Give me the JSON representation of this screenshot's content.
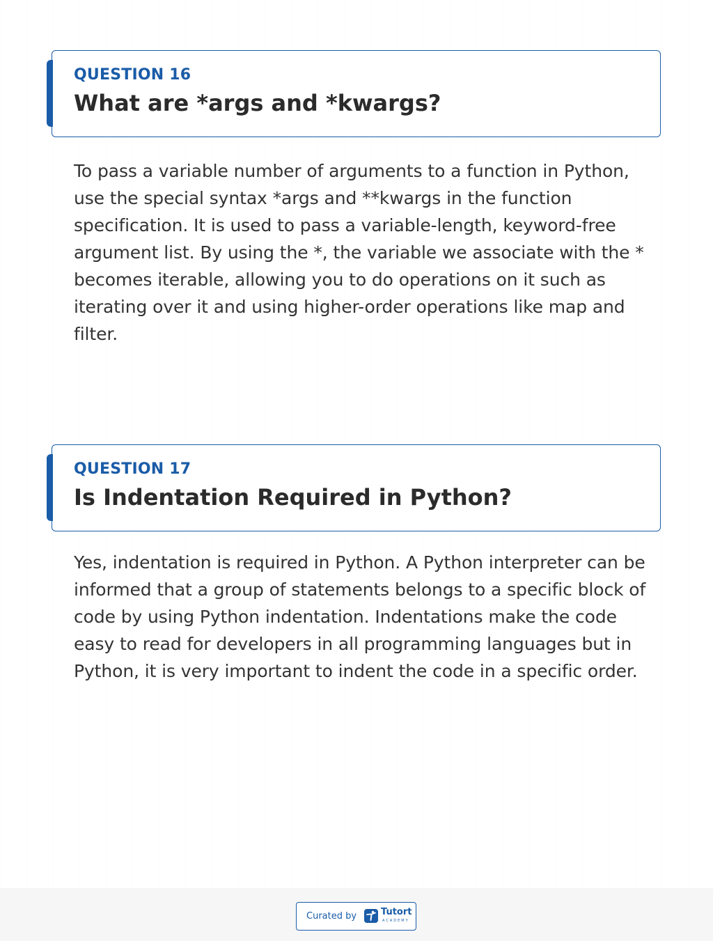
{
  "questions": [
    {
      "number_label": "QUESTION 16",
      "title": "What are *args and *kwargs?",
      "answer": "To pass a variable number of arguments to a function in Python, use the special syntax *args and **kwargs in the function specification. It is used to pass a variable-length, keyword-free argument list. By using the *, the variable we associate with the * becomes iterable, allowing you to do operations on it such as iterating over it and using higher-order operations like map and filter."
    },
    {
      "number_label": "QUESTION 17",
      "title": "Is Indentation Required in Python?",
      "answer": "Yes, indentation is required in Python. A Python interpreter can be informed that a group of statements belongs to a specific block of code by using Python indentation. Indentations make the code easy to read for developers in all programming languages but in Python, it is very important to indent the code in a specific order."
    }
  ],
  "footer": {
    "curated_label": "Curated by",
    "brand_name": "Tutort",
    "brand_sub": "ACADEMY"
  },
  "colors": {
    "accent": "#1a5ca8",
    "title_text": "#2b2b2b",
    "body_text": "#333333"
  }
}
